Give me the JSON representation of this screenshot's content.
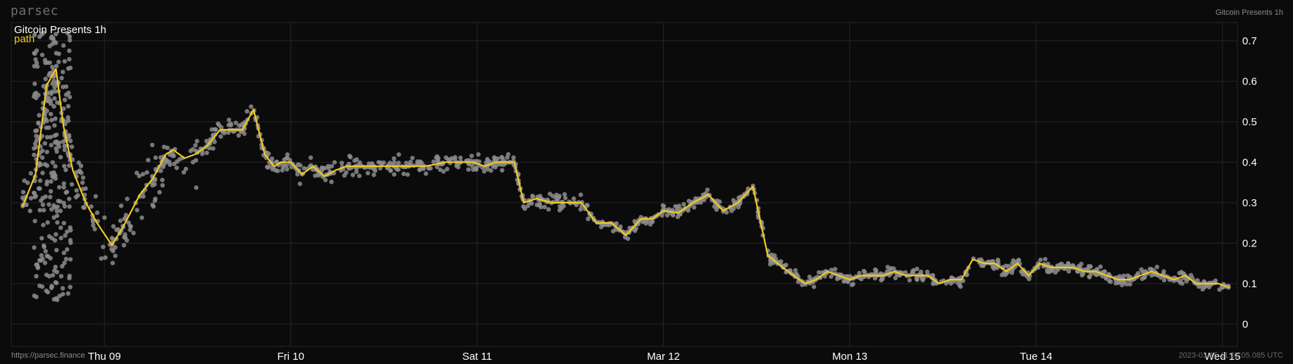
{
  "brand": "parsec",
  "header": {
    "title_right": "Gitcoin Presents 1h"
  },
  "footer": {
    "url": "https://parsec.finance",
    "timestamp": "2023-03-15 11:01:05.085 UTC"
  },
  "colors": {
    "background": "#0b0b0b",
    "grid": "#262626",
    "path": "#f2cb1f",
    "scatter": "#8c8c8c"
  },
  "chart_data": {
    "type": "line",
    "title": "Gitcoin Presents 1h",
    "legend": [
      "path"
    ],
    "legend_placement": "top-left",
    "grid": true,
    "x_ticks": [
      "Thu 09",
      "Fri 10",
      "Sat 11",
      "Mar 12",
      "Mon 13",
      "Tue 14",
      "Wed 15"
    ],
    "xlim": [
      -0.5,
      6.08
    ],
    "y_axis_side": "right",
    "y_ticks": [
      "0",
      "0.1",
      "0.2",
      "0.3",
      "0.4",
      "0.5",
      "0.6",
      "0.7"
    ],
    "ylim": [
      -0.055,
      0.745
    ],
    "series": [
      {
        "name": "path",
        "x": [
          -0.44,
          -0.37,
          -0.31,
          -0.26,
          -0.22,
          -0.17,
          -0.1,
          -0.04,
          0.04,
          0.1,
          0.19,
          0.26,
          0.33,
          0.37,
          0.43,
          0.49,
          0.55,
          0.62,
          0.68,
          0.74,
          0.8,
          0.86,
          0.91,
          0.95,
          1.0,
          1.06,
          1.12,
          1.18,
          1.24,
          1.3,
          1.36,
          1.42,
          1.48,
          1.54,
          1.6,
          1.66,
          1.72,
          1.78,
          1.83,
          1.87,
          1.92,
          1.98,
          2.04,
          2.1,
          2.16,
          2.2,
          2.25,
          2.32,
          2.4,
          2.48,
          2.56,
          2.64,
          2.72,
          2.8,
          2.88,
          2.94,
          3.0,
          3.08,
          3.16,
          3.24,
          3.32,
          3.4,
          3.48,
          3.56,
          3.64,
          3.7,
          3.76,
          3.82,
          3.88,
          3.94,
          4.0,
          4.06,
          4.12,
          4.18,
          4.24,
          4.3,
          4.36,
          4.42,
          4.48,
          4.54,
          4.6,
          4.66,
          4.72,
          4.78,
          4.84,
          4.9,
          4.96,
          5.02,
          5.08,
          5.14,
          5.2,
          5.26,
          5.32,
          5.38,
          5.44,
          5.5,
          5.56,
          5.62,
          5.68,
          5.74,
          5.8,
          5.86,
          5.92,
          5.98,
          6.04
        ],
        "values": [
          0.29,
          0.37,
          0.59,
          0.63,
          0.49,
          0.38,
          0.3,
          0.25,
          0.195,
          0.24,
          0.32,
          0.36,
          0.42,
          0.43,
          0.41,
          0.42,
          0.44,
          0.48,
          0.48,
          0.48,
          0.53,
          0.42,
          0.39,
          0.4,
          0.4,
          0.37,
          0.39,
          0.365,
          0.38,
          0.39,
          0.39,
          0.39,
          0.39,
          0.39,
          0.39,
          0.39,
          0.39,
          0.395,
          0.4,
          0.4,
          0.4,
          0.4,
          0.39,
          0.4,
          0.4,
          0.4,
          0.3,
          0.31,
          0.3,
          0.3,
          0.3,
          0.25,
          0.25,
          0.22,
          0.26,
          0.26,
          0.28,
          0.275,
          0.3,
          0.32,
          0.28,
          0.3,
          0.34,
          0.17,
          0.14,
          0.12,
          0.1,
          0.11,
          0.13,
          0.12,
          0.11,
          0.12,
          0.12,
          0.12,
          0.13,
          0.12,
          0.12,
          0.12,
          0.1,
          0.11,
          0.11,
          0.16,
          0.15,
          0.15,
          0.13,
          0.15,
          0.12,
          0.15,
          0.14,
          0.14,
          0.14,
          0.13,
          0.13,
          0.12,
          0.11,
          0.11,
          0.12,
          0.13,
          0.12,
          0.11,
          0.12,
          0.1,
          0.1,
          0.1,
          0.09
        ],
        "color": "#f2cb1f"
      }
    ]
  }
}
